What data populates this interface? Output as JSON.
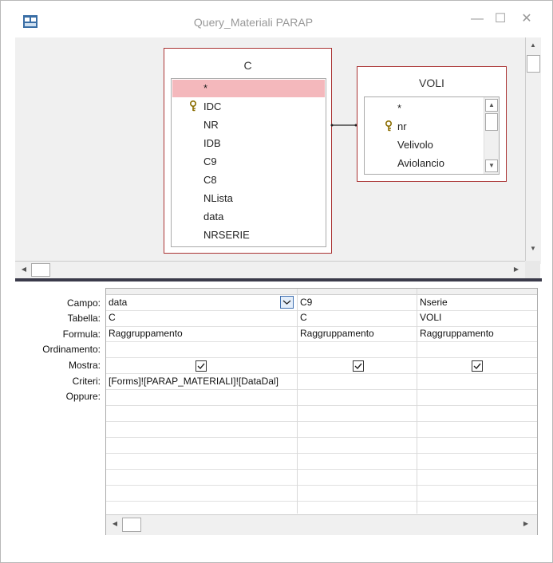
{
  "window": {
    "title": "Query_Materiali PARAP"
  },
  "titlebar": {
    "minimize": "—",
    "maximize": "☐",
    "close": "✕"
  },
  "tables": [
    {
      "name": "C",
      "fields": [
        "*",
        "IDC",
        "NR",
        "IDB",
        "C9",
        "C8",
        "NLista",
        "data",
        "NRSERIE"
      ],
      "key_field": "IDC"
    },
    {
      "name": "VOLI",
      "fields": [
        "*",
        "nr",
        "Velivolo",
        "Aviolancio"
      ],
      "key_field": "nr"
    }
  ],
  "grid": {
    "row_labels": [
      "Campo:",
      "Tabella:",
      "Formula:",
      "Ordinamento:",
      "Mostra:",
      "Criteri:",
      "Oppure:"
    ],
    "columns": [
      {
        "campo": "data",
        "tabella": "C",
        "formula": "Raggruppamento",
        "ordinamento": "",
        "mostra": true,
        "criteri": "[Forms]![PARAP_MATERIALI]![DataDal]",
        "oppure": ""
      },
      {
        "campo": "C9",
        "tabella": "C",
        "formula": "Raggruppamento",
        "ordinamento": "",
        "mostra": true,
        "criteri": "",
        "oppure": ""
      },
      {
        "campo": "Nserie",
        "tabella": "VOLI",
        "formula": "Raggruppamento",
        "ordinamento": "",
        "mostra": true,
        "criteri": "",
        "oppure": ""
      }
    ]
  },
  "colors": {
    "table_border": "#aa3333",
    "selected_field": "#f4b8bc",
    "diagram_bg": "#f0f0f0",
    "splitter": "#3a3a4a"
  }
}
